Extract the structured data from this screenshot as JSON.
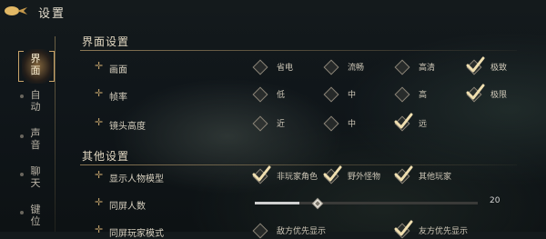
{
  "header": {
    "title": "设置"
  },
  "sidebar": {
    "items": [
      {
        "label": "界面",
        "active": true
      },
      {
        "label": "自动",
        "active": false
      },
      {
        "label": "声音",
        "active": false
      },
      {
        "label": "聊天",
        "active": false
      },
      {
        "label": "键位",
        "active": false
      }
    ]
  },
  "sections": {
    "interface": {
      "title": "界面设置",
      "settings": [
        {
          "label": "画面",
          "options": [
            {
              "label": "省电",
              "checked": false
            },
            {
              "label": "流畅",
              "checked": false
            },
            {
              "label": "高清",
              "checked": false
            },
            {
              "label": "极致",
              "checked": true
            }
          ]
        },
        {
          "label": "帧率",
          "options": [
            {
              "label": "低",
              "checked": false
            },
            {
              "label": "中",
              "checked": false
            },
            {
              "label": "高",
              "checked": false
            },
            {
              "label": "极限",
              "checked": true
            }
          ]
        },
        {
          "label": "镜头高度",
          "options": [
            {
              "label": "近",
              "checked": false
            },
            {
              "label": "中",
              "checked": false
            },
            {
              "label": "远",
              "checked": true
            }
          ]
        }
      ]
    },
    "other": {
      "title": "其他设置",
      "settings": [
        {
          "label": "显示人物模型",
          "options": [
            {
              "label": "非玩家角色",
              "checked": true
            },
            {
              "label": "野外怪物",
              "checked": true
            },
            {
              "label": "其他玩家",
              "checked": true
            }
          ]
        },
        {
          "label": "同屏人数",
          "slider": {
            "value": 20,
            "min": 0,
            "max": 100,
            "fraction": 0.2
          }
        },
        {
          "label": "同屏玩家模式",
          "options": [
            {
              "label": "敌方优先显示",
              "checked": false
            },
            {
              "label": "友方优先显示",
              "checked": true
            }
          ]
        }
      ]
    }
  },
  "colors": {
    "accent": "#c9a46a",
    "check": "#f0dfb0",
    "text": "#d6cfbe"
  }
}
